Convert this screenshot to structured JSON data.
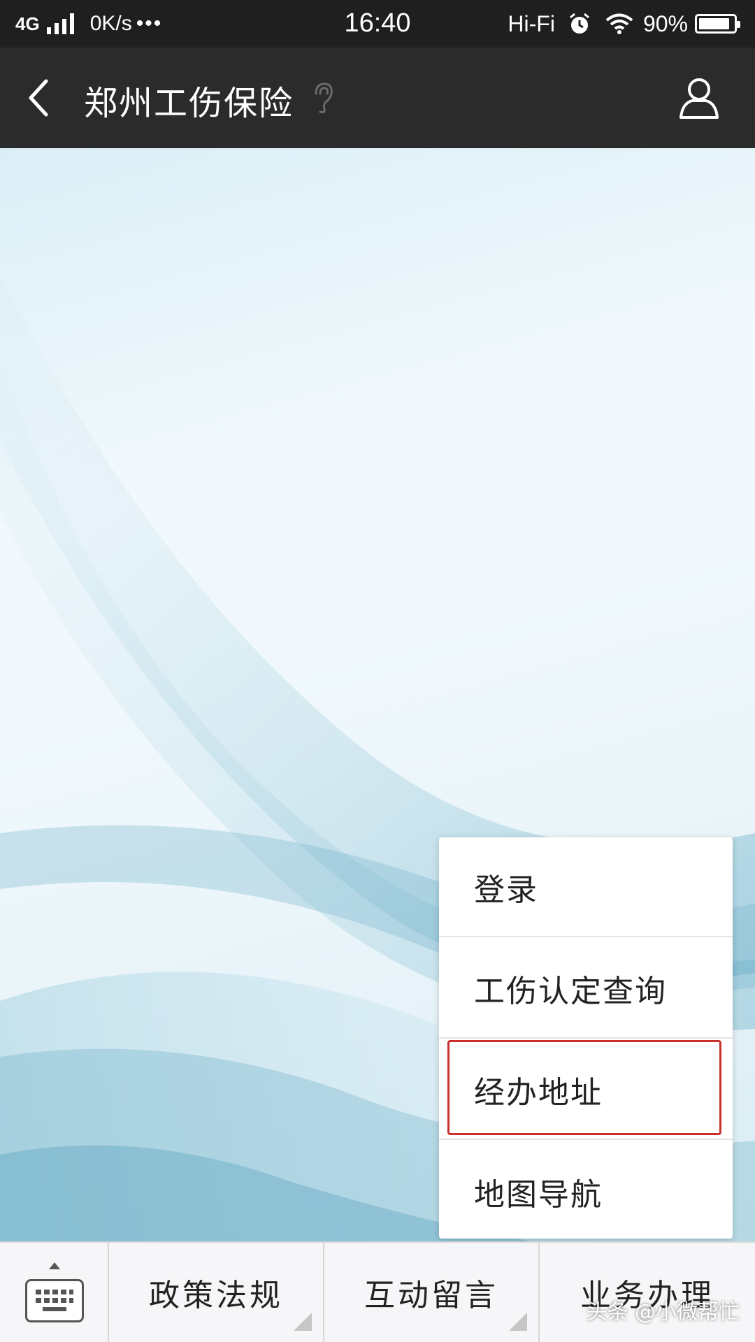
{
  "status_bar": {
    "network": "4G",
    "speed": "0K/s",
    "dots": "•••",
    "time": "16:40",
    "audio": "Hi-Fi",
    "battery_text": "90%",
    "battery_level": 0.9,
    "icons": [
      "signal-icon",
      "alarm-icon",
      "wifi-icon",
      "battery-icon"
    ]
  },
  "header": {
    "title": "郑州工伤保险",
    "back_icon": "chevron-left-icon",
    "ear_icon": "ear-icon",
    "profile_icon": "person-icon"
  },
  "popup_menu": {
    "items": [
      {
        "label": "登录"
      },
      {
        "label": "工伤认定查询"
      },
      {
        "label": "经办地址"
      },
      {
        "label": "地图导航"
      }
    ],
    "highlighted_index": 2,
    "highlight_color": "#c9302c"
  },
  "bottom_menu": {
    "keyboard_icon": "keyboard-icon",
    "tabs": [
      {
        "label": "政策法规"
      },
      {
        "label": "互动留言"
      },
      {
        "label": "业务办理"
      }
    ]
  },
  "watermark": "头条 @小微帮忙",
  "colors": {
    "status_bar_bg": "#1f1f1f",
    "title_bar_bg": "#2b2b2b",
    "background": "#e9f3f8",
    "bottom_bar_bg": "#f6f6f8"
  }
}
